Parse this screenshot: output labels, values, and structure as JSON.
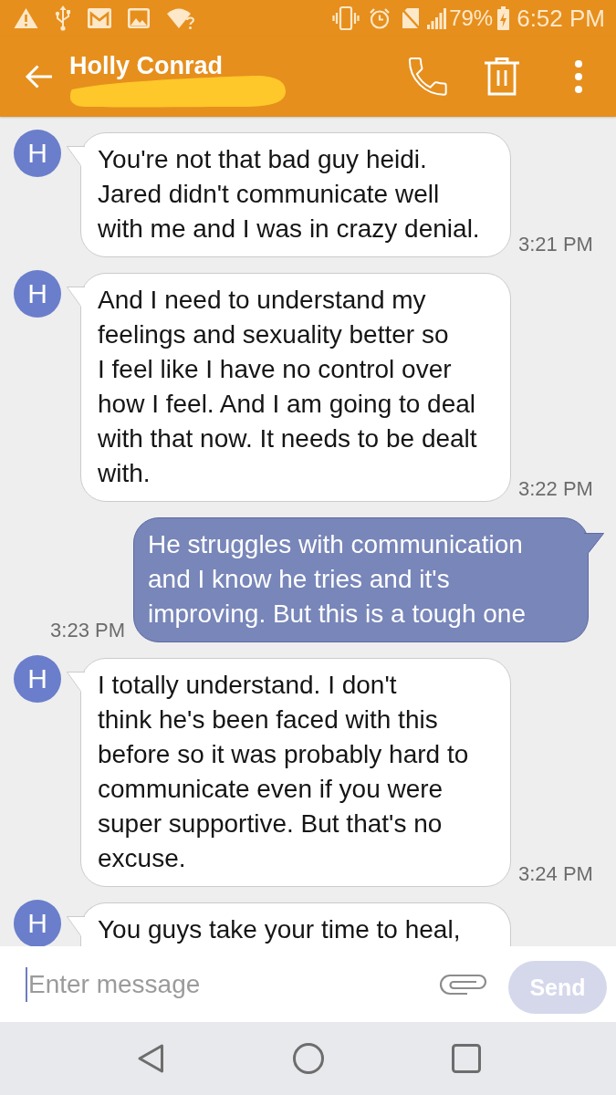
{
  "status_bar": {
    "battery_percent": "79%",
    "time": "6:52 PM"
  },
  "header": {
    "title": "Holly Conrad"
  },
  "messages": [
    {
      "kind": "received",
      "avatar": "H",
      "text": "You're not that bad guy heidi.\nJared didn't communicate well\nwith me and I was in crazy denial.",
      "time": "3:21 PM"
    },
    {
      "kind": "received",
      "avatar": "H",
      "text": "And I need to understand my\nfeelings and sexuality better so\nI feel like I have no control over\nhow I feel. And I am going to deal\nwith that now. It needs to be dealt\nwith.",
      "time": "3:22 PM"
    },
    {
      "kind": "sent",
      "text": "He struggles with communication\nand I know he tries and it's\nimproving. But this is a tough one",
      "time": "3:23 PM"
    },
    {
      "kind": "received",
      "avatar": "H",
      "text": "I totally understand. I don't\nthink he's been faced with this\nbefore so it was probably hard to\ncommunicate even if you were\nsuper supportive. But that's no\nexcuse.",
      "time": "3:24 PM"
    },
    {
      "kind": "received",
      "avatar": "H",
      "text": "You guys take your time to heal,"
    }
  ],
  "composer": {
    "placeholder": "Enter message",
    "focused": true,
    "send_button": {
      "label": "Send",
      "disabled": true
    }
  }
}
